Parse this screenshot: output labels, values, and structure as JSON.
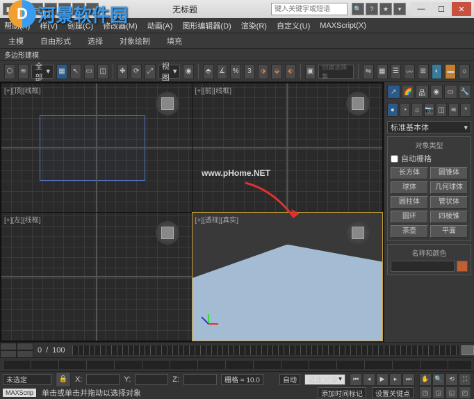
{
  "titlebar": {
    "title": "无标题",
    "search_placeholder": "键入关键字或短语"
  },
  "menubar": {
    "items": [
      "帮助(H)",
      "样(V)",
      "创建(C)",
      "修改器(M)",
      "动画(A)",
      "图形编辑器(D)",
      "渲染(R)",
      "自定义(U)",
      "MAXScript(X)"
    ]
  },
  "toolbar1": {
    "mode": "多边形建模",
    "labels": [
      "主模",
      "自由形式",
      "选择",
      "对象绘制",
      "填充"
    ]
  },
  "toolbar2": {
    "filter": "全部",
    "view": "视图"
  },
  "viewports": {
    "tl": "[+][顶][线框]",
    "tr": "[+][前][线框]",
    "bl": "[+][左][线框]",
    "br": "[+][透视][真实]"
  },
  "watermark": {
    "site1": "河景软件园",
    "url1": "www.pHome.NET"
  },
  "sidepanel": {
    "dropdown": "标准基本体",
    "section1_title": "对象类型",
    "autogrid": "自动栅格",
    "buttons": [
      "长方体",
      "圆锥体",
      "球体",
      "几何球体",
      "圆柱体",
      "管状体",
      "圆环",
      "四棱锥",
      "茶壶",
      "平面"
    ],
    "section2_title": "名称和颜色"
  },
  "timeline": {
    "start": "0",
    "end": "100"
  },
  "statusbar": {
    "none_selected": "未选定",
    "xlabel": "X:",
    "ylabel": "Y:",
    "zlabel": "Z:",
    "grid": "栅格 = 10.0",
    "auto": "自动",
    "filter": "选定对象",
    "add_time_tag": "添加时间标记",
    "set_keys": "设置关键点"
  },
  "statusbar2": {
    "maxscript": "MAXScrip",
    "hint": "单击或单击并拖动以选择对象"
  }
}
